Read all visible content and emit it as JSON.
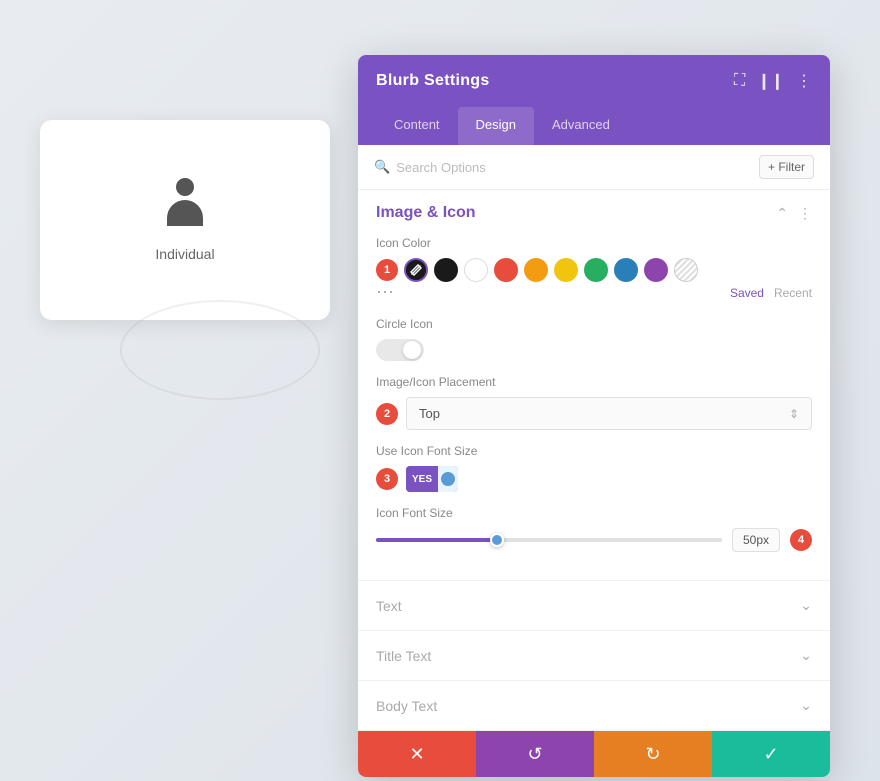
{
  "page": {
    "background_label": "Individual"
  },
  "panel": {
    "title": "Blurb Settings",
    "tabs": [
      {
        "id": "content",
        "label": "Content",
        "active": false
      },
      {
        "id": "design",
        "label": "Design",
        "active": true
      },
      {
        "id": "advanced",
        "label": "Advanced",
        "active": false
      }
    ],
    "search_placeholder": "Search Options",
    "filter_label": "+ Filter",
    "section_image_icon": {
      "title": "Image & Icon",
      "fields": {
        "icon_color_label": "Icon Color",
        "circle_icon_label": "Circle Icon",
        "circle_icon_value": "NO",
        "placement_label": "Image/Icon Placement",
        "placement_value": "Top",
        "use_icon_font_size_label": "Use Icon Font Size",
        "use_icon_font_toggle": "YES",
        "icon_font_size_label": "Icon Font Size",
        "icon_font_size_value": "50px"
      }
    },
    "section_text": {
      "title": "Text"
    },
    "section_title_text": {
      "title": "Title Text"
    },
    "section_body_text": {
      "title": "Body Text"
    },
    "footer": {
      "cancel_icon": "✕",
      "reset_icon": "↺",
      "redo_icon": "↻",
      "confirm_icon": "✓"
    },
    "steps": {
      "step1": "1",
      "step2": "2",
      "step3": "3",
      "step4": "4"
    },
    "saved_label": "Saved",
    "recent_label": "Recent"
  }
}
